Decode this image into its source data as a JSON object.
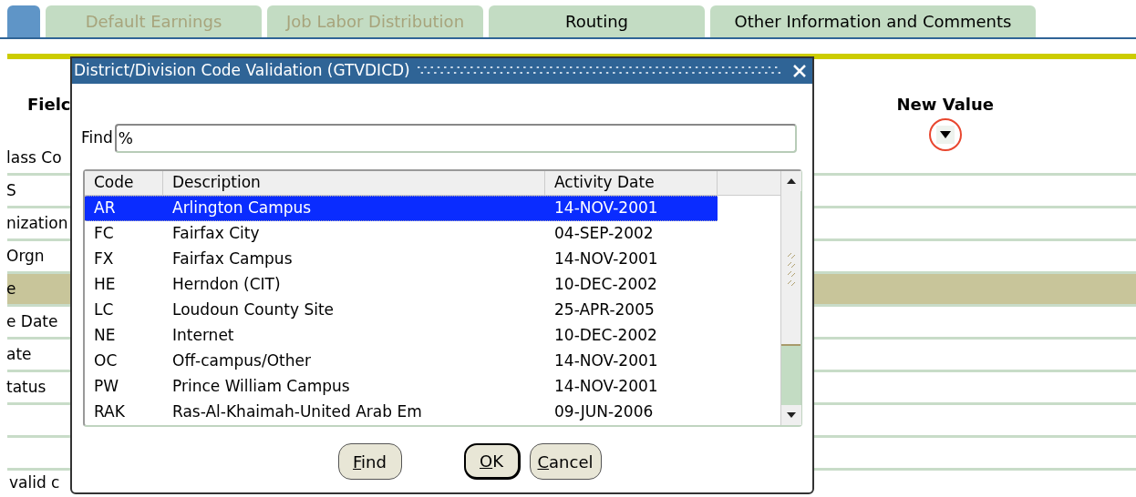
{
  "tabs": [
    {
      "selected": true,
      "disabled": false
    },
    {
      "label": "Default Earnings",
      "selected": false,
      "disabled": true
    },
    {
      "label": "Job Labor Distribution",
      "selected": false,
      "disabled": true
    },
    {
      "label": "Routing",
      "selected": false,
      "disabled": false
    },
    {
      "label": "Other Information and Comments",
      "selected": false,
      "disabled": false
    }
  ],
  "form": {
    "field_header": "Fielc",
    "new_value_header": "New Value",
    "rows": [
      {
        "label": "lass Co",
        "selected": false
      },
      {
        "label": "S",
        "selected": false
      },
      {
        "label": "nization",
        "selected": false
      },
      {
        "label": "Orgn",
        "selected": false
      },
      {
        "label": "e",
        "selected": true
      },
      {
        "label": "e Date",
        "selected": false
      },
      {
        "label": "ate",
        "selected": false
      },
      {
        "label": "tatus",
        "selected": false
      },
      {
        "selected": false
      },
      {
        "selected": false
      }
    ],
    "message": "valid c"
  },
  "dialog": {
    "title": "District/Division Code Validation (GTVDICD)",
    "find_label": "Find",
    "find_value": "%",
    "columns": [
      "Code",
      "Description",
      "Activity Date"
    ],
    "rows": [
      {
        "code": "AR",
        "description": "Arlington Campus",
        "date": "14-NOV-2001",
        "selected": true
      },
      {
        "code": "FC",
        "description": "Fairfax City",
        "date": "04-SEP-2002",
        "selected": false
      },
      {
        "code": "FX",
        "description": "Fairfax Campus",
        "date": "14-NOV-2001",
        "selected": false
      },
      {
        "code": "HE",
        "description": "Herndon (CIT)",
        "date": "10-DEC-2002",
        "selected": false
      },
      {
        "code": "LC",
        "description": "Loudoun County Site",
        "date": "25-APR-2005",
        "selected": false
      },
      {
        "code": "NE",
        "description": "Internet",
        "date": "10-DEC-2002",
        "selected": false
      },
      {
        "code": "OC",
        "description": "Off-campus/Other",
        "date": "14-NOV-2001",
        "selected": false
      },
      {
        "code": "PW",
        "description": "Prince William Campus",
        "date": "14-NOV-2001",
        "selected": false
      },
      {
        "code": "RAK",
        "description": "Ras-Al-Khaimah-United Arab Em",
        "date": "09-JUN-2006",
        "selected": false
      }
    ],
    "buttons": [
      {
        "label": "Find",
        "default": false
      },
      {
        "label": "OK",
        "default": true
      },
      {
        "label": "Cancel",
        "default": false
      }
    ]
  }
}
